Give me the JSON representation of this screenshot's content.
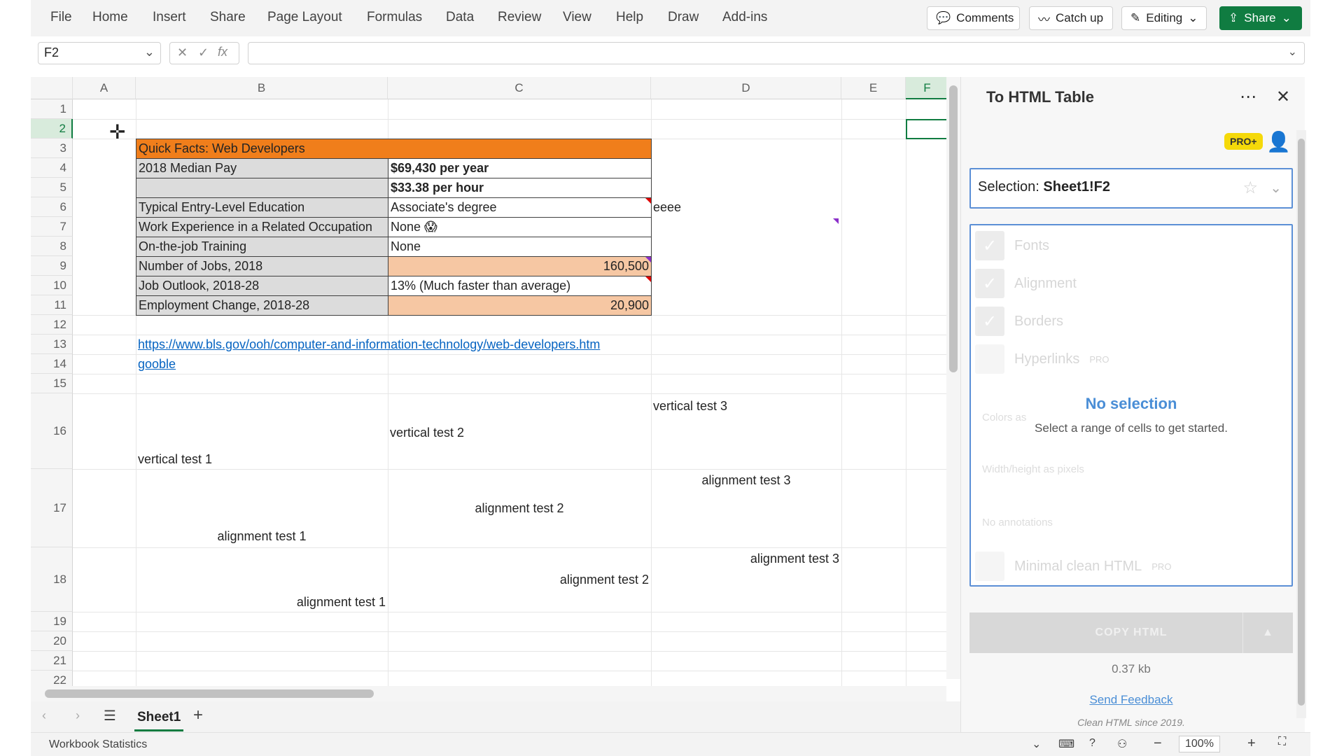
{
  "menu": [
    "File",
    "Home",
    "Insert",
    "Share",
    "Page Layout",
    "Formulas",
    "Data",
    "Review",
    "View",
    "Help",
    "Draw",
    "Add-ins"
  ],
  "top_buttons": {
    "comments": "Comments",
    "catchup": "Catch up",
    "editing": "Editing",
    "share": "Share"
  },
  "namebox": "F2",
  "fx_symbol": "fx",
  "columns": [
    "A",
    "B",
    "C",
    "D",
    "E",
    "F"
  ],
  "rows": [
    "1",
    "2",
    "3",
    "4",
    "5",
    "6",
    "7",
    "8",
    "9",
    "10",
    "11",
    "12",
    "13",
    "14",
    "15",
    "16",
    "17",
    "18",
    "19",
    "20",
    "21",
    "22"
  ],
  "sheet": {
    "title": "Quick Facts: Web Developers",
    "r4b": "2018 Median Pay",
    "r4c": "$69,430 per year",
    "r5c": "$33.38 per hour",
    "r6b": "Typical Entry-Level Education",
    "r6c": "Associate's degree",
    "r6d": "eeee",
    "r7b": "Work Experience in a Related Occupation",
    "r7c": "None 😱",
    "r8b": "On-the-job Training",
    "r8c": "None",
    "r9b": "Number of Jobs, 2018",
    "r9c": "160,500",
    "r10b": "Job Outlook, 2018-28",
    "r10c": "13% (Much faster than average)",
    "r11b": "Employment Change, 2018-28",
    "r11c": "20,900",
    "link1": "https://www.bls.gov/ooh/computer-and-information-technology/web-developers.htm",
    "link2": "gooble",
    "v1": "vertical test 1",
    "v2": "vertical test 2",
    "v3": "vertical test 3",
    "a1": "alignment test 1",
    "a2": "alignment test 2",
    "a3": "alignment test 3"
  },
  "sheet_tab": "Sheet1",
  "status": {
    "left": "Workbook Statistics",
    "zoom": "100%"
  },
  "panel": {
    "title": "To HTML Table",
    "badge": "PRO+",
    "selection_label": "Selection:",
    "selection_value": "Sheet1!F2",
    "options": [
      "Fonts",
      "Alignment",
      "Borders",
      "Hyperlinks"
    ],
    "pro_tag": "PRO",
    "nosel_title": "No selection",
    "nosel_sub": "Select a range of cells to get started.",
    "faded1": "Colors as",
    "faded2": "Width/height as pixels",
    "faded3": "No annotations",
    "minimal": "Minimal clean HTML",
    "copy": "COPY HTML",
    "size": "0.37 kb",
    "feedback": "Send Feedback",
    "clean": "Clean HTML since 2019."
  },
  "colors": {
    "accent": "#107c41",
    "orange": "#f07e1b",
    "peach": "#f6c7a3",
    "link": "#0563c1",
    "panel_blue": "#4a8ed6"
  }
}
